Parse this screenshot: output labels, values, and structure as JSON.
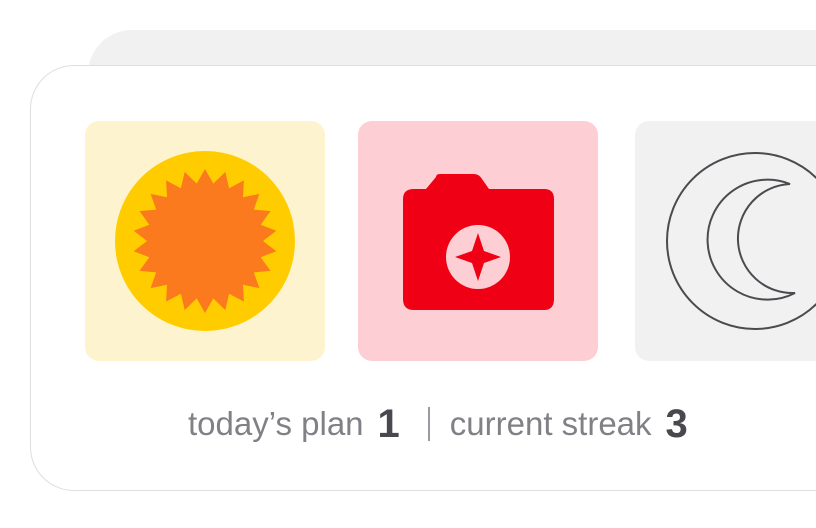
{
  "tiles": [
    {
      "icon": "sun-icon",
      "background": "#fdf4cf",
      "accent": "#ffcc00",
      "inner": "#fb7a1e"
    },
    {
      "icon": "camera-icon",
      "background": "#fdced3",
      "accent": "#ef0014",
      "inner": "#fdced3"
    },
    {
      "icon": "moon-icon",
      "background": "#f1f1f2",
      "accent": "#4a4a4f"
    }
  ],
  "stats": {
    "plan_label": "today’s plan",
    "plan_value": "1",
    "streak_label": "current streak",
    "streak_value": "3"
  }
}
